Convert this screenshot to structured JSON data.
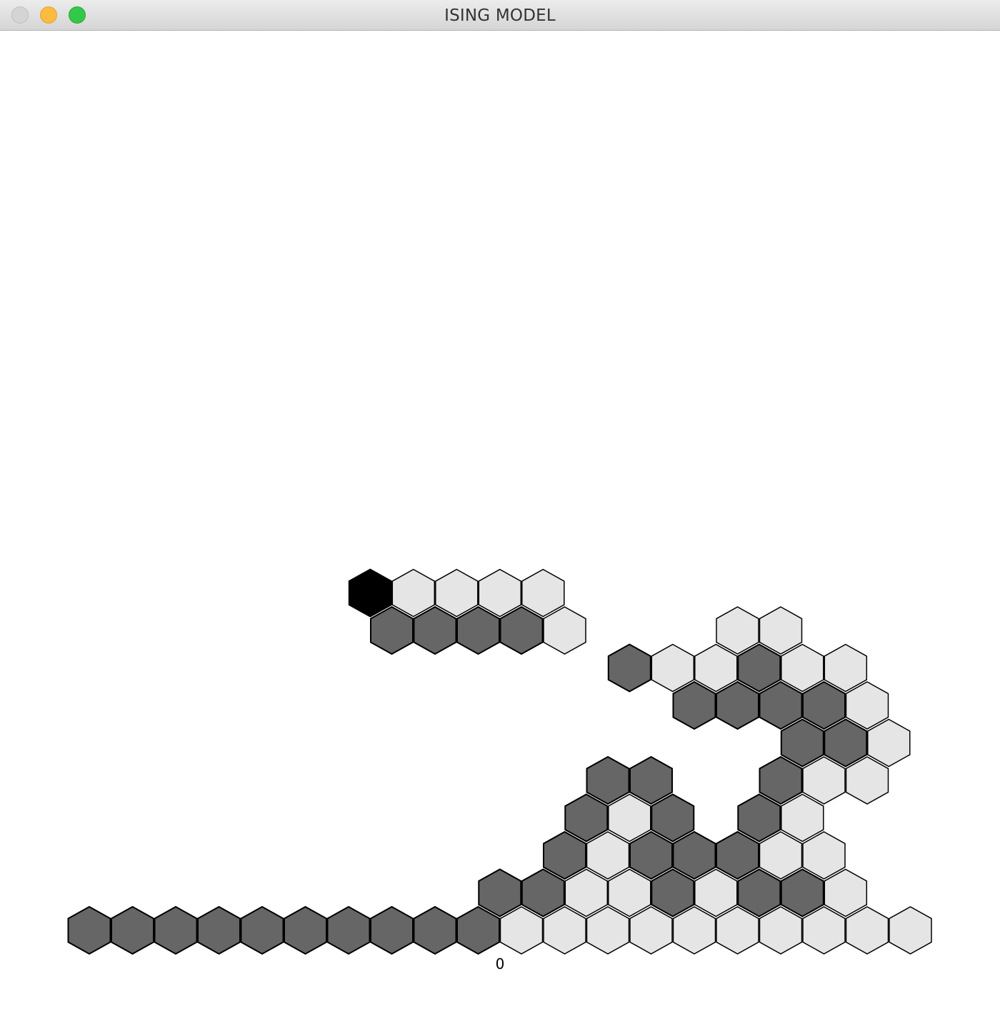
{
  "window": {
    "title": "ISING MODEL"
  },
  "colors": {
    "spin_up": "#e5e5e5",
    "spin_down": "#666666",
    "selected": "#000000",
    "outline": "#000000"
  },
  "lattice": {
    "origin_label": "0",
    "rows": [
      {
        "row": 0,
        "cells": [
          {
            "col": -10,
            "state": "down"
          },
          {
            "col": -9,
            "state": "down"
          },
          {
            "col": -8,
            "state": "down"
          },
          {
            "col": -7,
            "state": "down"
          },
          {
            "col": -6,
            "state": "down"
          },
          {
            "col": -5,
            "state": "down"
          },
          {
            "col": -4,
            "state": "down"
          },
          {
            "col": -3,
            "state": "down"
          },
          {
            "col": -2,
            "state": "down"
          },
          {
            "col": -1,
            "state": "down"
          },
          {
            "col": 0,
            "state": "up"
          },
          {
            "col": 1,
            "state": "up"
          },
          {
            "col": 2,
            "state": "up"
          },
          {
            "col": 3,
            "state": "up"
          },
          {
            "col": 4,
            "state": "up"
          },
          {
            "col": 5,
            "state": "up"
          },
          {
            "col": 6,
            "state": "up"
          },
          {
            "col": 7,
            "state": "up"
          },
          {
            "col": 8,
            "state": "up"
          },
          {
            "col": 9,
            "state": "up"
          }
        ]
      },
      {
        "row": 1,
        "cells": [
          {
            "col": 0,
            "state": "down"
          },
          {
            "col": 1,
            "state": "down"
          },
          {
            "col": 2,
            "state": "up"
          },
          {
            "col": 3,
            "state": "up"
          },
          {
            "col": 4,
            "state": "down"
          },
          {
            "col": 5,
            "state": "up"
          },
          {
            "col": 6,
            "state": "down"
          },
          {
            "col": 7,
            "state": "down"
          },
          {
            "col": 8,
            "state": "up"
          }
        ]
      },
      {
        "row": 2,
        "cells": [
          {
            "col": 2,
            "state": "down"
          },
          {
            "col": 3,
            "state": "up"
          },
          {
            "col": 4,
            "state": "down"
          },
          {
            "col": 5,
            "state": "down"
          },
          {
            "col": 6,
            "state": "down"
          },
          {
            "col": 7,
            "state": "up"
          },
          {
            "col": 8,
            "state": "up"
          }
        ]
      },
      {
        "row": 3,
        "cells": [
          {
            "col": 3,
            "state": "down"
          },
          {
            "col": 4,
            "state": "up"
          },
          {
            "col": 5,
            "state": "down"
          },
          {
            "col": 7,
            "state": "down"
          },
          {
            "col": 8,
            "state": "up"
          }
        ]
      },
      {
        "row": 4,
        "cells": [
          {
            "col": 4,
            "state": "down"
          },
          {
            "col": 5,
            "state": "down"
          },
          {
            "col": 8,
            "state": "down"
          },
          {
            "col": 9,
            "state": "up"
          },
          {
            "col": 10,
            "state": "up"
          }
        ]
      },
      {
        "row": 5,
        "cells": [
          {
            "col": 9,
            "state": "down"
          },
          {
            "col": 10,
            "state": "down"
          },
          {
            "col": 11,
            "state": "up"
          }
        ]
      },
      {
        "row": 6,
        "cells": [
          {
            "col": 7,
            "state": "down"
          },
          {
            "col": 8,
            "state": "down"
          },
          {
            "col": 9,
            "state": "down"
          },
          {
            "col": 10,
            "state": "down"
          },
          {
            "col": 11,
            "state": "up"
          }
        ]
      },
      {
        "row": 7,
        "cells": [
          {
            "col": 6,
            "state": "down"
          },
          {
            "col": 7,
            "state": "up"
          },
          {
            "col": 8,
            "state": "up"
          },
          {
            "col": 9,
            "state": "down"
          },
          {
            "col": 10,
            "state": "up"
          },
          {
            "col": 11,
            "state": "up"
          }
        ]
      },
      {
        "row": 8,
        "cells": [
          {
            "col": 1,
            "state": "down"
          },
          {
            "col": 2,
            "state": "down"
          },
          {
            "col": 3,
            "state": "down"
          },
          {
            "col": 4,
            "state": "down"
          },
          {
            "col": 5,
            "state": "up"
          },
          {
            "col": 9,
            "state": "up"
          },
          {
            "col": 10,
            "state": "up"
          }
        ]
      },
      {
        "row": 9,
        "cells": [
          {
            "col": 1,
            "state": "selected"
          },
          {
            "col": 2,
            "state": "up"
          },
          {
            "col": 3,
            "state": "up"
          },
          {
            "col": 4,
            "state": "up"
          },
          {
            "col": 5,
            "state": "up"
          }
        ]
      }
    ]
  }
}
